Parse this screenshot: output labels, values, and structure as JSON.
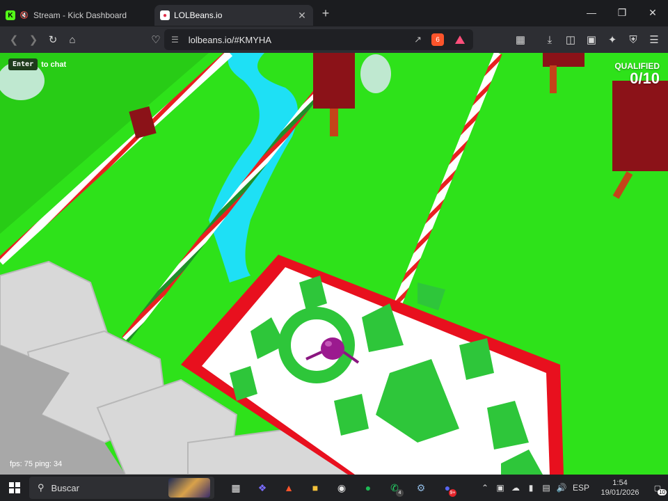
{
  "browser": {
    "tabs": [
      {
        "title": "Stream - Kick Dashboard",
        "icon": "kick-logo-icon",
        "muted": true,
        "active": false
      },
      {
        "title": "LOLBeans.io",
        "icon": "lolbeans-icon",
        "active": true
      }
    ],
    "url": "lolbeans.io/#KMYHA",
    "brave_badge": "6"
  },
  "game": {
    "chat_key": "Enter",
    "chat_hint": "to chat",
    "qualified_label": "QUALIFIED",
    "qualified_value": "0/10",
    "fps_text": "fps: 75 ping: 34",
    "colors": {
      "grass": "#2ee21a",
      "river": "#1ee0f5",
      "platform_border": "#e8101e",
      "platform_pattern": "#2ec63a",
      "player": "#9b1a8f"
    }
  },
  "taskbar": {
    "search_placeholder": "Buscar",
    "apps": [
      {
        "name": "task-view-icon",
        "badge": ""
      },
      {
        "name": "copilot-icon",
        "badge": ""
      },
      {
        "name": "brave-icon",
        "badge": ""
      },
      {
        "name": "file-explorer-icon",
        "badge": ""
      },
      {
        "name": "obs-icon",
        "badge": ""
      },
      {
        "name": "spotify-icon",
        "badge": ""
      },
      {
        "name": "whatsapp-icon",
        "badge": "4"
      },
      {
        "name": "steam-icon",
        "badge": ""
      },
      {
        "name": "discord-icon",
        "badge": "9+"
      }
    ],
    "language": "ESP",
    "time": "1:54",
    "date": "19/01/2026",
    "notifications": "10"
  }
}
